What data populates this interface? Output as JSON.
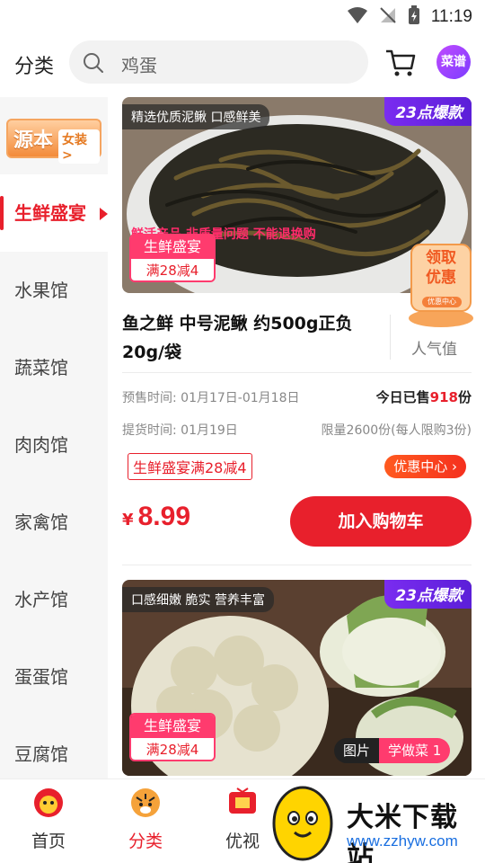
{
  "status_bar": {
    "time": "11:19"
  },
  "header": {
    "title": "分类",
    "search_placeholder": "鸡蛋",
    "recipe_label": "菜谱"
  },
  "sidebar": {
    "banner": {
      "big": "源本",
      "small": "女装>"
    },
    "items": [
      {
        "label": "生鲜盛宴",
        "active": true
      },
      {
        "label": "水果馆"
      },
      {
        "label": "蔬菜馆"
      },
      {
        "label": "肉肉馆"
      },
      {
        "label": "家禽馆"
      },
      {
        "label": "水产馆"
      },
      {
        "label": "蛋蛋馆"
      },
      {
        "label": "豆腐馆"
      }
    ]
  },
  "products": [
    {
      "tagline": "精选优质泥鳅 口感鲜美",
      "hot_badge": "23点爆款",
      "overlay_text": "鲜活产品 非质量问题 不能退换购",
      "promo_top": "生鲜盛宴",
      "promo_bottom": "满28减4",
      "name": "鱼之鲜 中号泥鳅 约500g正负20g/袋",
      "popularity_label": "人气值",
      "presale": "预售时间: 01月17日-01月18日",
      "sold_prefix": "今日已售",
      "sold_count": "918",
      "sold_suffix": "份",
      "pickup": "提货时间: 01月19日",
      "limit": "限量2600份(每人限购3份)",
      "coupon": "生鲜盛宴满28减4",
      "discount_center": "优惠中心 ›",
      "currency": "¥",
      "price": "8.99",
      "add_to_cart": "加入购物车"
    },
    {
      "tagline": "口感细嫩 脆实 营养丰富",
      "hot_badge": "23点爆款",
      "promo_top": "生鲜盛宴",
      "promo_bottom": "满28减4",
      "pic_label": "图片",
      "cook_label": "学做菜 1"
    }
  ],
  "float_badge": {
    "line1": "领取",
    "line2": "优惠",
    "line3": "优惠中心"
  },
  "bottom_nav": [
    {
      "label": "首页"
    },
    {
      "label": "分类",
      "active": true
    },
    {
      "label": "优视"
    }
  ],
  "watermark": {
    "title": "大米下载站",
    "url": "www.zzhyw.com"
  },
  "colors": {
    "accent": "#e8202c",
    "hot_badge": "#6a25e6",
    "promo": "#ff3b6e"
  }
}
